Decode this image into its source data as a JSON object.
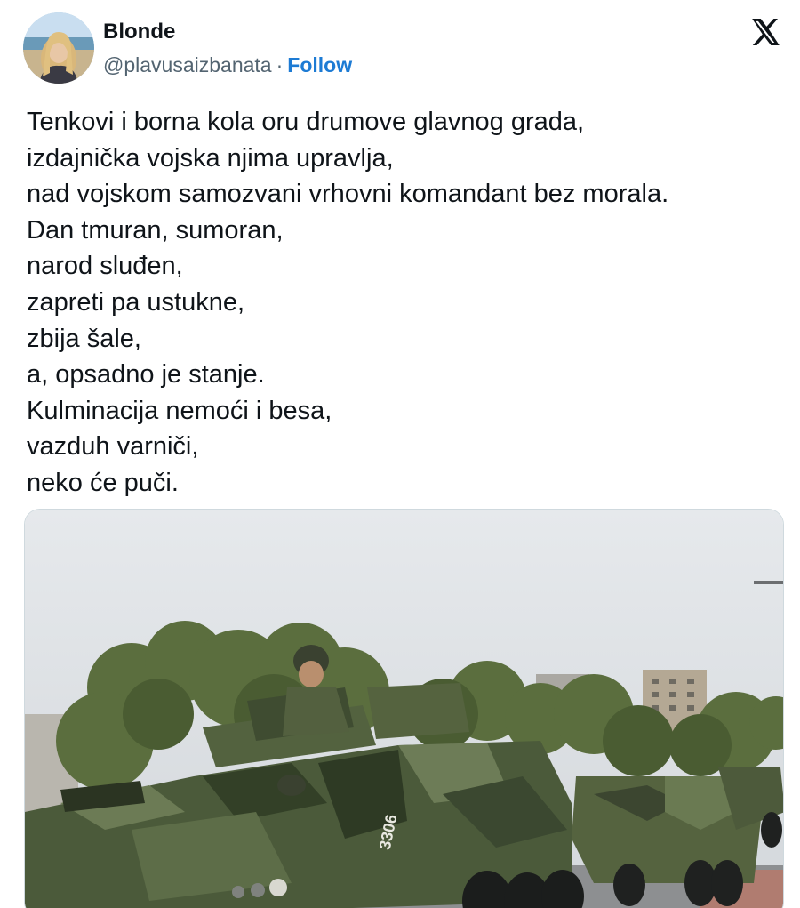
{
  "author": {
    "display_name": "Blonde",
    "handle": "@plavusaizbanata",
    "separator": "·",
    "follow_label": "Follow"
  },
  "icons": {
    "platform_logo": "x-logo-icon",
    "avatar": "avatar-image"
  },
  "colors": {
    "text": "#0f1419",
    "secondary": "#536471",
    "follow": "#1d7bd4"
  },
  "tweet": {
    "lines": [
      "Tenkovi i borna kola oru drumove glavnog grada,",
      "izdajnička vojska njima upravlja,",
      "nad vojskom samozvani vrhovni komandant bez morala.",
      "Dan tmuran, sumoran,",
      "narod sluđen,",
      "zapreti pa ustukne,",
      "zbija šale,",
      "a, opsadno je stanje.",
      "Kulminacija nemoći i besa,",
      "vazduh varniči,",
      "neko će puči."
    ]
  },
  "media": {
    "vehicle_number": "3306"
  }
}
